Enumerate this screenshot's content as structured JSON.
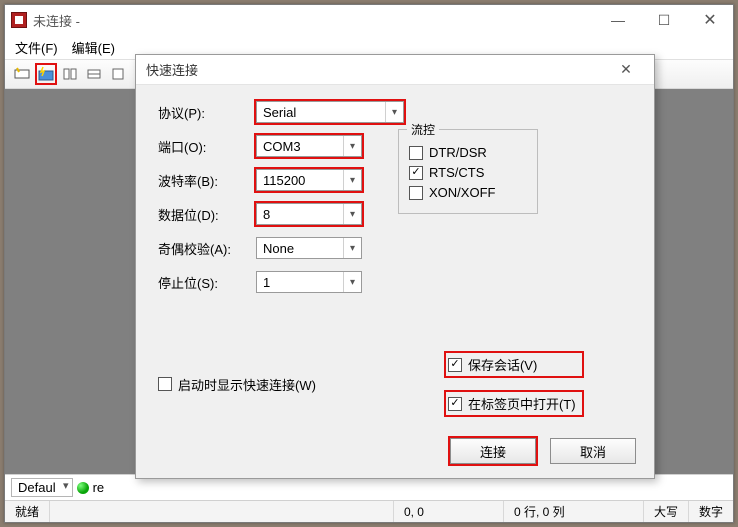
{
  "window": {
    "title": "未连接 -",
    "menu": {
      "file": "文件(F)",
      "edit": "编辑(E)"
    },
    "winbtn_min": "—",
    "winbtn_max": "☐",
    "winbtn_close": "✕"
  },
  "bottombar": {
    "default_label": "Defaul",
    "rel_label": "re"
  },
  "statusbar": {
    "ready": "就绪",
    "pos": "0, 0",
    "rowcol": "0 行, 0 列",
    "caps": "大写",
    "num": "数字"
  },
  "dialog": {
    "title": "快速连接",
    "close_glyph": "✕",
    "labels": {
      "protocol": "协议(P):",
      "port": "端口(O):",
      "baud": "波特率(B):",
      "databits": "数据位(D):",
      "parity": "奇偶校验(A):",
      "stopbits": "停止位(S):",
      "flow": "流控"
    },
    "values": {
      "protocol": "Serial",
      "port": "COM3",
      "baud": "115200",
      "databits": "8",
      "parity": "None",
      "stopbits": "1"
    },
    "flow": {
      "dtr": "DTR/DSR",
      "rts": "RTS/CTS",
      "xon": "XON/XOFF"
    },
    "checks": {
      "show_on_start": "启动时显示快速连接(W)",
      "save_session": "保存会话(V)",
      "open_in_tab": "在标签页中打开(T)"
    },
    "buttons": {
      "connect": "连接",
      "cancel": "取消"
    }
  }
}
